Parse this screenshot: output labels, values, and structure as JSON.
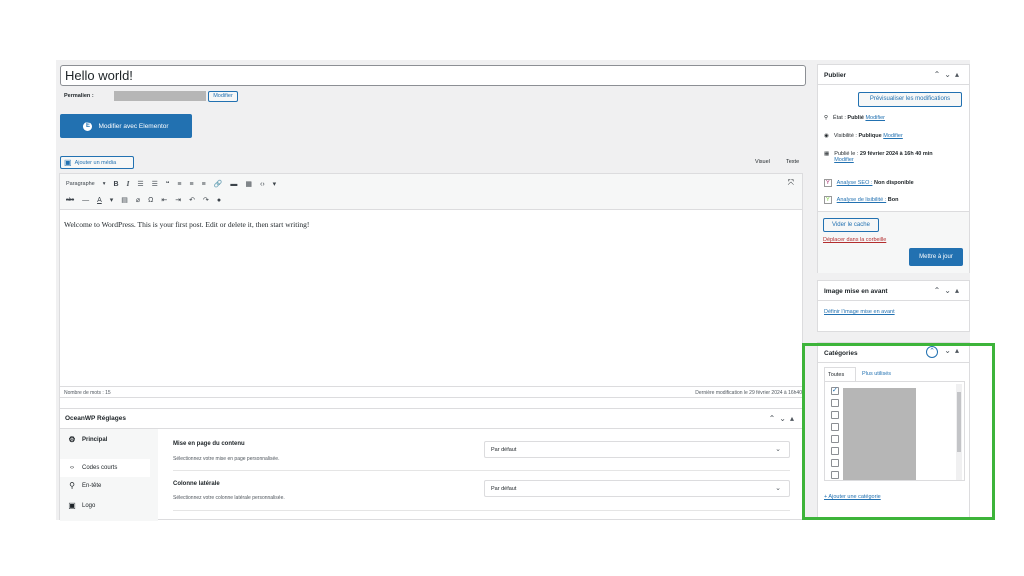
{
  "post": {
    "title": "Hello world!",
    "permalink_label": "Permalien :",
    "modify_label": "Modifier",
    "elementor_button": "Modifier avec Elementor",
    "elementor_icon": "E",
    "add_media": "Ajouter un média",
    "tab_visual": "Visuel",
    "tab_text": "Texte",
    "format_select": "Paragraphe",
    "content": "Welcome to WordPress. This is your first post. Edit or delete it, then start writing!",
    "word_count": "Nombre de mots : 15",
    "last_modified": "Dernière modification le 29 février 2024 à 16h40"
  },
  "oceanwp": {
    "title": "OceanWP Réglages",
    "nav": [
      {
        "label": "Principal",
        "icon": "gear-icon"
      },
      {
        "label": "Codes courts",
        "icon": "code-icon"
      },
      {
        "label": "En-tête",
        "icon": "pin-icon"
      },
      {
        "label": "Logo",
        "icon": "image-icon"
      }
    ],
    "settings": [
      {
        "title": "Mise en page du contenu",
        "desc": "Sélectionnez votre mise en page personnalisée.",
        "value": "Par défaut"
      },
      {
        "title": "Colonne latérale",
        "desc": "Sélectionnez votre colonne latérale personnalisée.",
        "value": "Par défaut"
      }
    ]
  },
  "publish": {
    "title": "Publier",
    "preview": "Prévisualiser les modifications",
    "state_label": "État : ",
    "state_value": "Publié",
    "state_link": "Modifier",
    "visibility_label": "Visibilité : ",
    "visibility_value": "Publique",
    "visibility_link": "Modifier",
    "published_label": "Publié le : ",
    "published_value": "29 février 2024 à 16h 40 min",
    "published_link": "Modifier",
    "seo_link": "Analyse SEO :",
    "seo_value": "Non disponible",
    "read_link": "Analyse de lisibilité :",
    "read_value": "Bon",
    "cache_button": "Vider le cache",
    "trash_link": "Déplacer dans la corbeille",
    "update_button": "Mettre à jour"
  },
  "featured": {
    "title": "Image mise en avant",
    "link": "Définir l’image mise en avant"
  },
  "categories": {
    "title": "Catégories",
    "tab_all": "Toutes",
    "tab_used": "Plus utilisés",
    "add_link": "+ Ajouter une catégorie",
    "checked": [
      true,
      false,
      false,
      false,
      false,
      false,
      false,
      false
    ]
  },
  "colors": {
    "accent": "#2271b1",
    "highlight": "#3db43a",
    "background": "#f0f0f1"
  }
}
